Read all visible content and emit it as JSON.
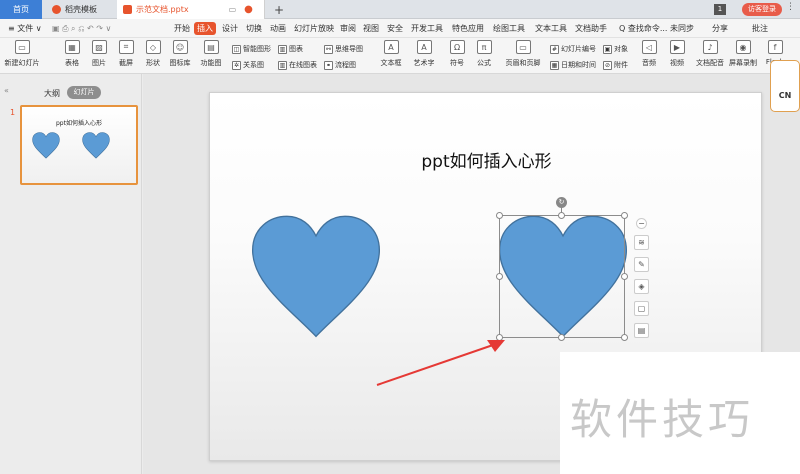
{
  "tabs": {
    "home": "首页",
    "template": "稻壳模板",
    "document": "示范文档.pptx",
    "add": "+"
  },
  "window": {
    "num": "1",
    "login": "访客登录",
    "more": "⋮"
  },
  "menu": {
    "file": "≡ 文件 ∨",
    "items": [
      "开始",
      "插入",
      "设计",
      "切换",
      "动画",
      "幻灯片放映",
      "审阅",
      "视图",
      "安全",
      "开发工具",
      "特色应用",
      "绘图工具",
      "文本工具",
      "文档助手"
    ],
    "search": "Q 查找命令...",
    "sync": "未同步",
    "share": "分享",
    "comment": "批注"
  },
  "ribbon": {
    "new_slide": "新建幻灯片",
    "table": "表格",
    "picture": "图片",
    "screenshot": "截屏",
    "shape": "形状",
    "icon_lib": "图标库",
    "func_chart": "功能图",
    "smart_shape": "智能图形",
    "chart": "图表",
    "mind_map": "思维导图",
    "relation": "关系图",
    "online_chart": "在线图表",
    "flowchart": "流程图",
    "textbox": "文本框",
    "art_text": "艺术字",
    "symbol": "符号",
    "formula": "公式",
    "header_footer": "页眉和页脚",
    "slide_number": "幻灯片编号",
    "object": "对象",
    "datetime": "日期和时间",
    "attachment": "附件",
    "audio": "音频",
    "video": "视频",
    "doc_voice": "文档配音",
    "screen_record": "屏幕录制",
    "flash": "Flash"
  },
  "left_pane": {
    "outline": "大纲",
    "slides": "幻灯片",
    "slide_number": "1",
    "thumb_title": "ppt如何插入心形"
  },
  "slide": {
    "title": "ppt如何插入心形"
  },
  "badge": "CN",
  "watermark": "软件技巧",
  "colors": {
    "heart_fill": "#5b9bd5",
    "heart_stroke": "#41719c",
    "accent": "#e7542d",
    "arrow": "#e53935"
  }
}
